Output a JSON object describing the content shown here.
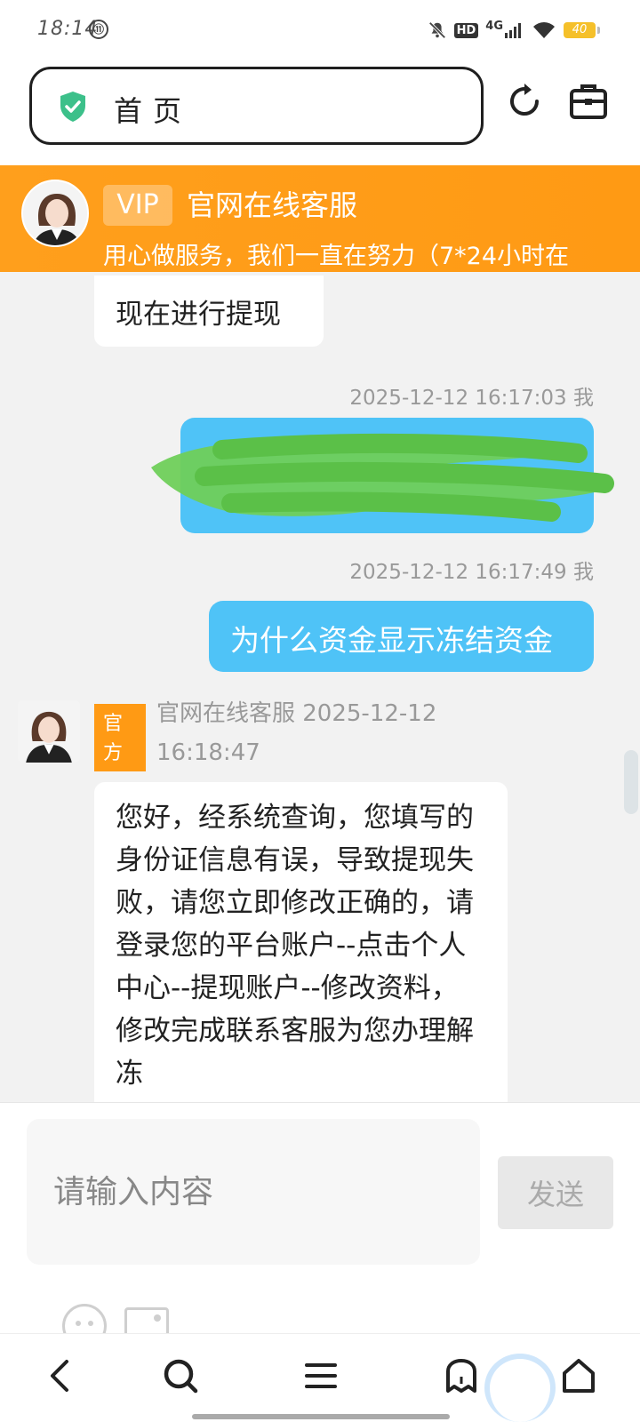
{
  "status_bar": {
    "time": "18:14",
    "network": "4G",
    "hd": "HD",
    "battery": "40"
  },
  "browser": {
    "address_text": "首页",
    "icons": [
      "shield-check-icon",
      "refresh-icon",
      "toolbox-icon"
    ]
  },
  "chat_header": {
    "vip": "VIP",
    "title": "官网在线客服",
    "subtitle": "用心做服务，我们一直在努力（7*24小时在"
  },
  "messages": [
    {
      "side": "agent",
      "text": "现在进行提现"
    },
    {
      "side": "user",
      "time": "2025-12-12 16:17:03 我",
      "text": "",
      "redacted": true
    },
    {
      "side": "user",
      "time": "2025-12-12 16:17:49 我",
      "text": "为什么资金显示冻结资金"
    },
    {
      "side": "agent",
      "badge": "官方",
      "sender": "官网在线客服 2025-12-12",
      "time_line2": "16:18:47",
      "text": "您好，经系统查询，您填写的身份证信息有误，导致提现失败，请您立即修改正确的，请登录您的平台账户--点击个人中心--提现账户--修改资料，修改完成联系客服为您办理解冻"
    }
  ],
  "input": {
    "placeholder": "请输入内容",
    "send_label": "发送"
  },
  "colors": {
    "header_orange": "#ff9a14",
    "user_bubble": "#4fc3f7",
    "official_badge": "#ff9a14",
    "shield_green": "#3cc08a"
  }
}
